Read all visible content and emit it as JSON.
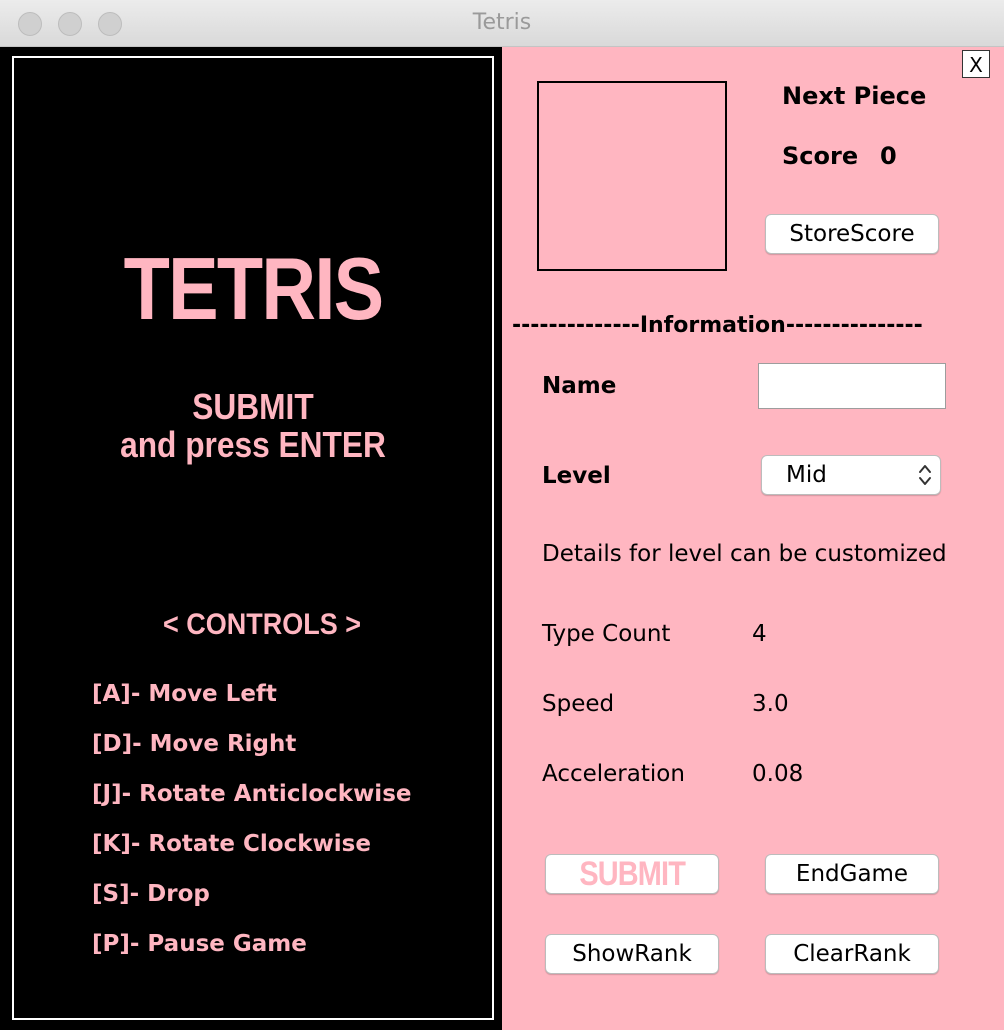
{
  "window": {
    "title": "Tetris"
  },
  "board": {
    "title": "TETRIS",
    "message_line1": "SUBMIT",
    "message_line2": "and press ENTER",
    "controls_heading": "< CONTROLS >",
    "controls": [
      "[A]- Move Left",
      "[D]- Move Right",
      "[J]- Rotate Anticlockwise",
      "[K]- Rotate Clockwise",
      "[S]- Drop",
      "[P]- Pause Game"
    ]
  },
  "panel": {
    "close_label": "X",
    "next_piece_label": "Next Piece",
    "score_label": "Score",
    "score_value": "0",
    "store_score_label": "StoreScore",
    "information_divider": "--------------Information---------------",
    "name_label": "Name",
    "name_value": "",
    "level_label": "Level",
    "level_value": "Mid",
    "details_text": "Details for level can be customized",
    "type_count_label": "Type Count",
    "type_count_value": "4",
    "speed_label": "Speed",
    "speed_value": "3.0",
    "acceleration_label": "Acceleration",
    "acceleration_value": "0.08",
    "submit_label": "SUBMIT",
    "endgame_label": "EndGame",
    "showrank_label": "ShowRank",
    "clearrank_label": "ClearRank"
  },
  "colors": {
    "accent_pink": "#ffb6c1",
    "board_background": "#000000"
  }
}
